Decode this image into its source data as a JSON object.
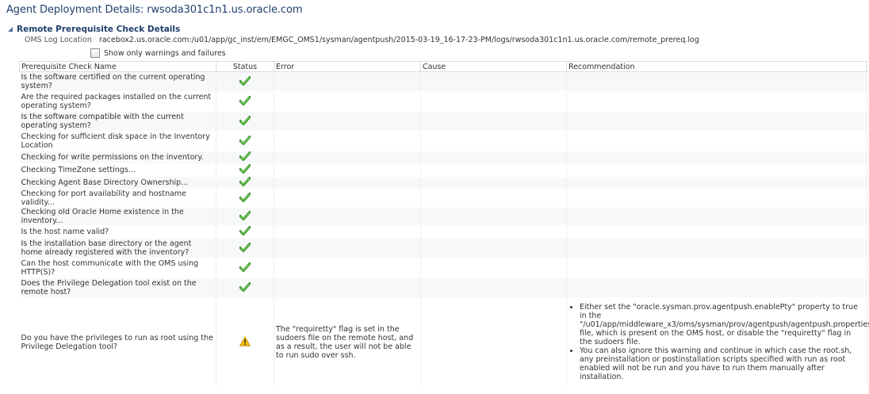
{
  "page_title": "Agent Deployment Details: rwsoda301c1n1.us.oracle.com",
  "section": {
    "title": "Remote Prerequisite Check Details",
    "oms_log_label": "OMS Log Location",
    "oms_log_value": "racebox2.us.oracle.com:/u01/app/gc_inst/em/EMGC_OMS1/sysman/agentpush/2015-03-19_16-17-23-PM/logs/rwsoda301c1n1.us.oracle.com/remote_prereq.log",
    "filter_label": "Show only warnings and failures"
  },
  "table": {
    "headers": [
      "Prerequisite Check Name",
      "Status",
      "Error",
      "Cause",
      "Recommendation"
    ],
    "rows": [
      {
        "name": "Is the software certified on the current operating system?",
        "status": "check-icon",
        "error": "",
        "cause": "",
        "recommendation": ""
      },
      {
        "name": "Are the required packages installed on the current operating system?",
        "status": "check-icon",
        "error": "",
        "cause": "",
        "recommendation": ""
      },
      {
        "name": "Is the software compatible with the current operating system?",
        "status": "check-icon",
        "error": "",
        "cause": "",
        "recommendation": ""
      },
      {
        "name": "Checking for sufficient disk space in the Inventory Location",
        "status": "check-icon",
        "error": "",
        "cause": "",
        "recommendation": ""
      },
      {
        "name": "Checking for write permissions on the inventory.",
        "status": "check-icon",
        "error": "",
        "cause": "",
        "recommendation": ""
      },
      {
        "name": "Checking TimeZone settings...",
        "status": "check-icon",
        "error": "",
        "cause": "",
        "recommendation": ""
      },
      {
        "name": "Checking Agent Base Directory Ownership...",
        "status": "check-icon",
        "error": "",
        "cause": "",
        "recommendation": ""
      },
      {
        "name": "Checking for port availability and hostname validity...",
        "status": "check-icon",
        "error": "",
        "cause": "",
        "recommendation": ""
      },
      {
        "name": "Checking old Oracle Home existence in the inventory...",
        "status": "check-icon",
        "error": "",
        "cause": "",
        "recommendation": ""
      },
      {
        "name": "Is the host name valid?",
        "status": "check-icon",
        "error": "",
        "cause": "",
        "recommendation": ""
      },
      {
        "name": "Is the installation base directory or the agent home already registered with the inventory?",
        "status": "check-icon",
        "error": "",
        "cause": "",
        "recommendation": ""
      },
      {
        "name": "Can the host communicate with the OMS using HTTP(S)?",
        "status": "check-icon",
        "error": "",
        "cause": "",
        "recommendation": ""
      },
      {
        "name": "Does the Privilege Delegation tool exist on the remote host?",
        "status": "check-icon",
        "error": "",
        "cause": "",
        "recommendation": ""
      },
      {
        "name": "Do you have the privileges to run as root using the Privilege Delegation tool?",
        "status": "warning-icon",
        "error": "The \"requiretty\" flag is set in the sudoers file on the remote host, and as a result, the user will not be able to run sudo over ssh.",
        "cause": "",
        "recommendation_items": [
          "Either set the \"oracle.sysman.prov.agentpush.enablePty\" property to true in the \"/u01/app/middleware_x3/oms/sysman/prov/agentpush/agentpush.properties\" file, which is present on the OMS host, or disable the \"requiretty\" flag in the sudoers file.",
          "You can also ignore this warning and continue in which case the root.sh, any preinstallation or postinstallation scripts specified with run as root enabled will not be run and you have to run them manually after installation."
        ]
      }
    ]
  },
  "colors": {
    "title": "#1f3f6b",
    "check": "#3aa02a",
    "warning": "#f0b400"
  }
}
